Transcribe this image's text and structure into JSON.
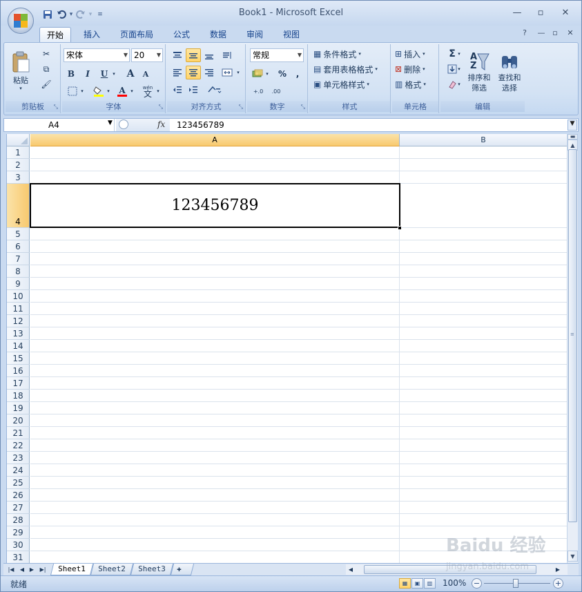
{
  "window": {
    "title": "Book1 - Microsoft Excel",
    "controls": [
      "minimize-icon",
      "restore-icon",
      "close-icon"
    ]
  },
  "quick_access": {
    "icons": [
      "save-icon",
      "undo-icon",
      "redo-icon",
      "customize-icon"
    ]
  },
  "ribbon_tabs": [
    "开始",
    "插入",
    "页面布局",
    "公式",
    "数据",
    "审阅",
    "视图"
  ],
  "active_tab": "开始",
  "ribbon": {
    "clipboard": {
      "label": "剪贴板",
      "paste": "粘贴",
      "icons": [
        "cut-icon",
        "copy-icon",
        "format-painter-icon"
      ]
    },
    "font": {
      "label": "字体",
      "font_name": "宋体",
      "font_size": "20",
      "bold": "B",
      "italic": "I",
      "underline": "U",
      "grow": "A",
      "shrink": "A",
      "font_color_letter": "A",
      "phonetic": "wén",
      "phonetic_glyph": "文"
    },
    "alignment": {
      "label": "对齐方式"
    },
    "number": {
      "label": "数字",
      "format": "常规",
      "percent": "%",
      "comma": ",",
      "increase_decimal": "+.0",
      "decrease_decimal": ".00"
    },
    "styles": {
      "label": "样式",
      "conditional": "条件格式",
      "table": "套用表格格式",
      "cell_styles": "单元格样式"
    },
    "cells": {
      "label": "单元格",
      "insert": "插入",
      "delete": "删除",
      "format": "格式"
    },
    "editing": {
      "label": "编辑",
      "sum": "Σ",
      "sort_filter_1": "排序和",
      "sort_filter_2": "筛选",
      "find_select_1": "查找和",
      "find_select_2": "选择",
      "sort_glyph_a": "A",
      "sort_glyph_z": "Z"
    }
  },
  "formula_bar": {
    "name_box": "A4",
    "fx": "fx",
    "value": "123456789"
  },
  "grid": {
    "columns": [
      "A",
      "B"
    ],
    "selected_column": "A",
    "rows": [
      "1",
      "2",
      "3",
      "4",
      "5",
      "6",
      "7",
      "8",
      "9",
      "10",
      "11",
      "12",
      "13",
      "14",
      "15",
      "16",
      "17",
      "18",
      "19",
      "20",
      "21",
      "22",
      "23",
      "24",
      "25",
      "26",
      "27",
      "28",
      "29",
      "30",
      "31"
    ],
    "selected_row": "4",
    "active_cell": {
      "ref": "A4",
      "value": "123456789"
    }
  },
  "sheets": [
    "Sheet1",
    "Sheet2",
    "Sheet3"
  ],
  "active_sheet": "Sheet1",
  "status": {
    "text": "就绪",
    "zoom": "100%",
    "minus": "−",
    "plus": "+"
  },
  "watermark": {
    "logo": "Baidu 经验",
    "url": "jingyan.baidu.com"
  }
}
